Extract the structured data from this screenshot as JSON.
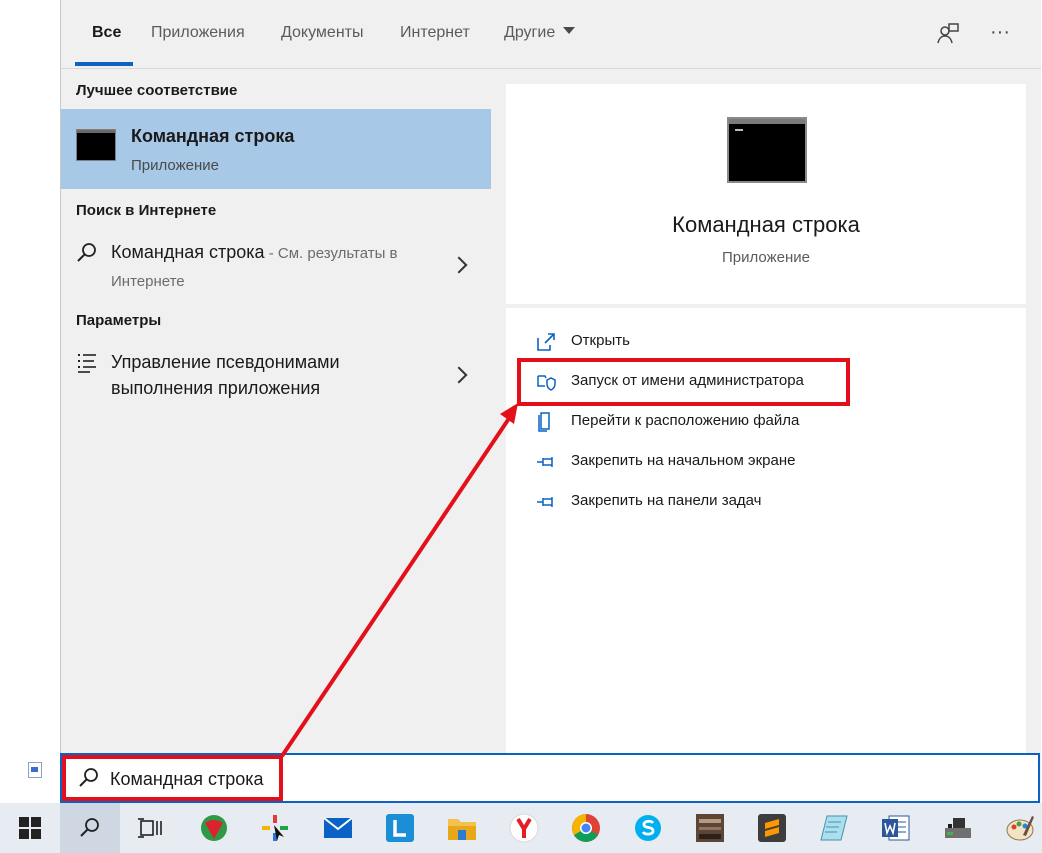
{
  "tabs": {
    "all": "Все",
    "apps": "Приложения",
    "documents": "Документы",
    "web": "Интернет",
    "other": "Другие"
  },
  "left": {
    "best_match_title": "Лучшее соответствие",
    "best_match": {
      "title": "Командная строка",
      "subtitle": "Приложение"
    },
    "web_title": "Поиск в Интернете",
    "web_result": {
      "query": "Командная строка",
      "suffix": " - См. результаты в",
      "line2": "Интернете"
    },
    "settings_title": "Параметры",
    "settings_result": {
      "line1": "Управление псевдонимами",
      "line2": "выполнения приложения"
    }
  },
  "preview": {
    "title": "Командная строка",
    "subtitle": "Приложение"
  },
  "actions": [
    {
      "label": "Открыть",
      "icon": "open-icon"
    },
    {
      "label": "Запуск от имени администратора",
      "icon": "shield-icon"
    },
    {
      "label": "Перейти к расположению файла",
      "icon": "file-location-icon"
    },
    {
      "label": "Закрепить на начальном экране",
      "icon": "pin-icon"
    },
    {
      "label": "Закрепить на панели задач",
      "icon": "pin-icon"
    }
  ],
  "search": {
    "value": "Командная строка"
  },
  "taskbar_apps": [
    "windows-start",
    "search",
    "task-view",
    "app-green-shield",
    "app-pinwheel",
    "mail",
    "app-l",
    "file-explorer",
    "yandex-browser",
    "chrome",
    "skype",
    "app-photo",
    "sublime-text",
    "notepad",
    "word",
    "app-drive",
    "paint"
  ],
  "colors": {
    "accent": "#0a63c4",
    "selection": "#a8c8e8",
    "annotation": "#e3101c"
  }
}
